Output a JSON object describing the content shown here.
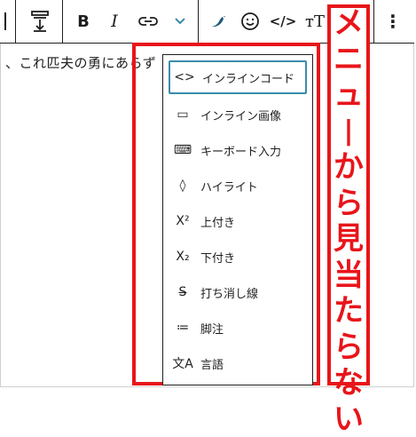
{
  "toolbar": {
    "buttons": [
      {
        "name": "block-mover-button",
        "icon": "⇕"
      },
      {
        "name": "bold-button",
        "label": "B"
      },
      {
        "name": "italic-button",
        "label": "I"
      },
      {
        "name": "link-button",
        "icon": "link-icon"
      },
      {
        "name": "more-rich-text-button",
        "icon": "chevron-down-icon"
      },
      {
        "name": "plugin-bird-button",
        "icon": "bird-icon"
      },
      {
        "name": "emoji-button",
        "icon": "smile-icon"
      },
      {
        "name": "code-button",
        "label": "</>"
      },
      {
        "name": "font-size-button",
        "label": "тT"
      },
      {
        "name": "more-options-button",
        "label": "⋮"
      }
    ],
    "bold": "B",
    "italic": "I",
    "code": "</>",
    "font_size": "тT",
    "more": "⋮"
  },
  "editor": {
    "text": "、これ匹夫の勇にあらず"
  },
  "menu": {
    "items": [
      {
        "icon": "<>",
        "label": "インラインコード"
      },
      {
        "icon": "▭",
        "label": "インライン画像"
      },
      {
        "icon": "⌨",
        "label": "キーボード入力"
      },
      {
        "icon": "◊",
        "label": "ハイライト"
      },
      {
        "icon": "X²",
        "label": "上付き"
      },
      {
        "icon": "X₂",
        "label": "下付き"
      },
      {
        "icon": "S̶",
        "label": "打ち消し線"
      },
      {
        "icon": "≔",
        "label": "脚注"
      },
      {
        "icon": "文A",
        "label": "言語"
      }
    ]
  },
  "annotation": {
    "text": "メニューから見当たらない",
    "color": "#e8151a"
  },
  "colors": {
    "accent": "#3a8cab",
    "highlight_red": "#e8151a",
    "chevron_blue": "#3a8cab"
  }
}
